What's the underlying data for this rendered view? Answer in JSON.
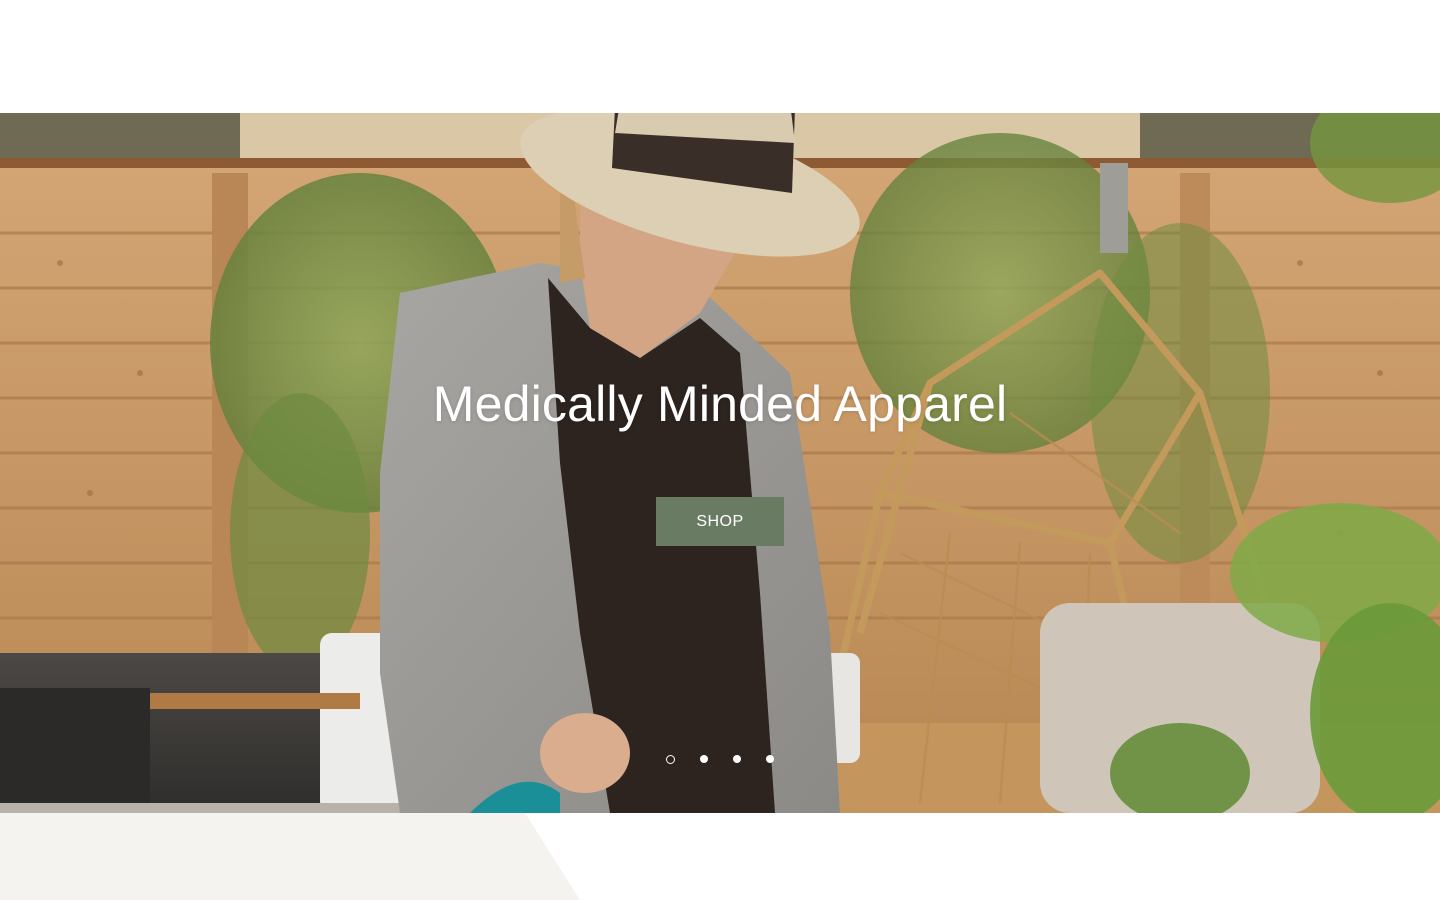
{
  "hero": {
    "title": "Medically Minded Apparel",
    "shop_label": "SHOP",
    "button_color": "#6a7b63"
  },
  "slideshow": {
    "slide_count": 4,
    "active_index": 0,
    "dots": [
      {
        "label": "slide-1"
      },
      {
        "label": "slide-2"
      },
      {
        "label": "slide-3"
      },
      {
        "label": "slide-4"
      }
    ]
  },
  "colors": {
    "accent_shape": "#f4f3ef",
    "fence": "#c8975f"
  }
}
